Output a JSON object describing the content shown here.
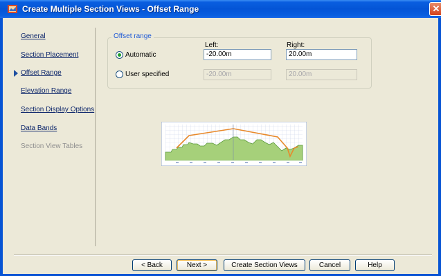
{
  "window": {
    "title": "Create Multiple Section Views - Offset Range",
    "close": "✕"
  },
  "nav": {
    "items": [
      {
        "label": "General"
      },
      {
        "label": "Section Placement"
      },
      {
        "label": "Offset Range"
      },
      {
        "label": "Elevation Range"
      },
      {
        "label": "Section Display Options"
      },
      {
        "label": "Data Bands"
      },
      {
        "label": "Section View Tables"
      }
    ]
  },
  "offset": {
    "group_label": "Offset range",
    "left_label": "Left:",
    "right_label": "Right:",
    "automatic": {
      "label": "Automatic",
      "left": "-20.00m",
      "right": "20.00m",
      "selected": true
    },
    "user": {
      "label": "User specified",
      "left": "-20.00m",
      "right": "20.00m",
      "selected": false
    }
  },
  "buttons": {
    "back": "< Back",
    "next": "Next >",
    "create": "Create Section Views",
    "cancel": "Cancel",
    "help": "Help"
  },
  "colors": {
    "title_bar": "#0454d6",
    "ground": "#a6d07a",
    "profile": "#e8892b"
  }
}
